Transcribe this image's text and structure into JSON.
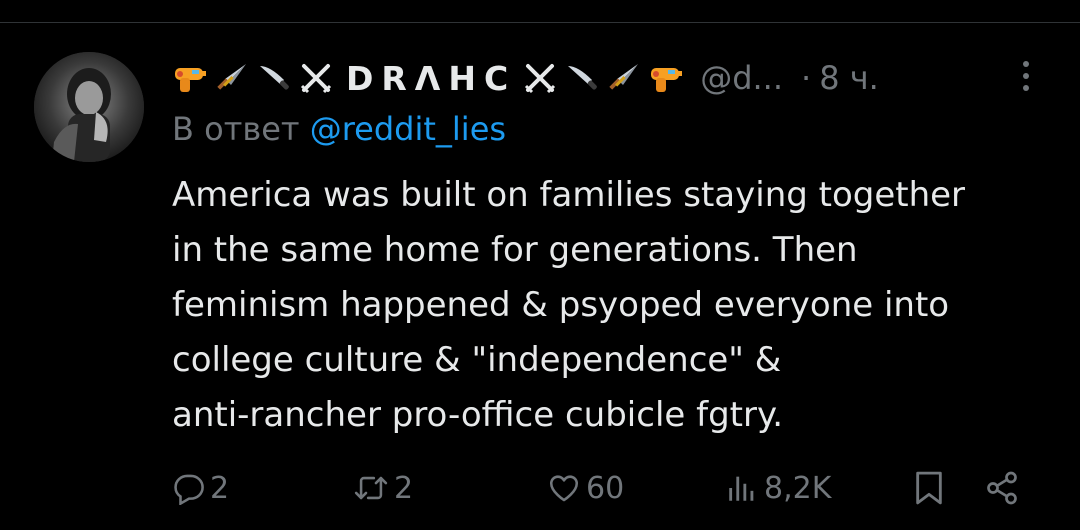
{
  "tweet": {
    "author_name": "DRΛHC",
    "handle": "@d...",
    "separator": "·",
    "time": "8 ч.",
    "reply_prefix": "В ответ",
    "reply_to": "@reddit_lies",
    "text_lines": [
      "America was built on families staying together",
      "in the same home for generations. Then",
      "feminism happened & psyoped everyone into",
      "college culture & \"independence\" &",
      "anti-rancher pro-office cubicle fgtry."
    ]
  },
  "actions": {
    "replies": "2",
    "reposts": "2",
    "likes": "60",
    "views": "8,2K"
  },
  "icons": {
    "name_decorations_left": [
      "water-pistol-icon",
      "dagger-icon",
      "kitchen-knife-icon",
      "crossed-swords-icon"
    ],
    "name_decorations_right": [
      "crossed-swords-icon",
      "kitchen-knife-icon",
      "dagger-icon",
      "water-pistol-icon"
    ],
    "reply": "reply-icon",
    "repost": "repost-icon",
    "like": "heart-icon",
    "views": "views-icon",
    "bookmark": "bookmark-icon",
    "share": "share-icon",
    "more": "more-icon"
  },
  "colors": {
    "background": "#000000",
    "text": "#e7e9ea",
    "secondary": "#71767b",
    "link": "#1d9bf0"
  }
}
